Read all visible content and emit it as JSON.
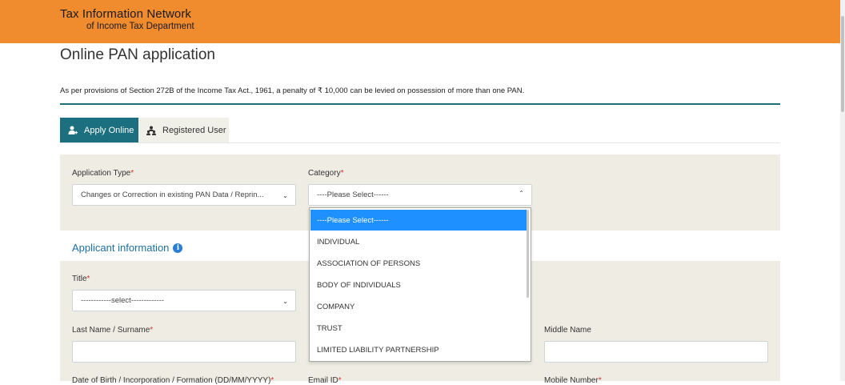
{
  "header": {
    "title": "Tax Information Network",
    "subtitle": "of Income Tax Department",
    "bg_color": "#f18c2e"
  },
  "page": {
    "title": "Online PAN application",
    "notice": "As per provisions of Section 272B of the Income Tax Act., 1961, a penalty of ₹ 10,000 can be levied on possession of more than one PAN."
  },
  "tabs": [
    {
      "label": "Apply Online",
      "icon": "user-add-icon",
      "active": true
    },
    {
      "label": "Registered User",
      "icon": "users-icon",
      "active": false
    }
  ],
  "form": {
    "application_type": {
      "label": "Application Type",
      "required_mark": "*",
      "value": "Changes or Correction in existing PAN Data / Reprin..."
    },
    "category": {
      "label": "Category",
      "required_mark": "*",
      "value": "----Please Select------",
      "options": [
        "----Please Select------",
        "INDIVIDUAL",
        "ASSOCIATION OF PERSONS",
        "BODY OF INDIVIDUALS",
        "COMPANY",
        "TRUST",
        "LIMITED LIABILITY PARTNERSHIP"
      ]
    },
    "applicant_section": "Applicant information",
    "title": {
      "label": "Title",
      "required_mark": "*",
      "value": "------------select-------------"
    },
    "last_name": {
      "label": "Last Name / Surname",
      "required_mark": "*",
      "value": ""
    },
    "middle_name": {
      "label": "Middle Name",
      "value": ""
    },
    "dob": {
      "label": "Date of Birth / Incorporation / Formation (DD/MM/YYYY)",
      "required_mark": "*"
    },
    "email": {
      "label": "Email ID",
      "required_mark": "*"
    },
    "mobile": {
      "label": "Mobile Number",
      "required_mark": "*"
    }
  },
  "colors": {
    "accent": "#1b6f7e",
    "panel": "#efede3",
    "selected_option": "#1e90ff",
    "required": "#d9302c"
  }
}
